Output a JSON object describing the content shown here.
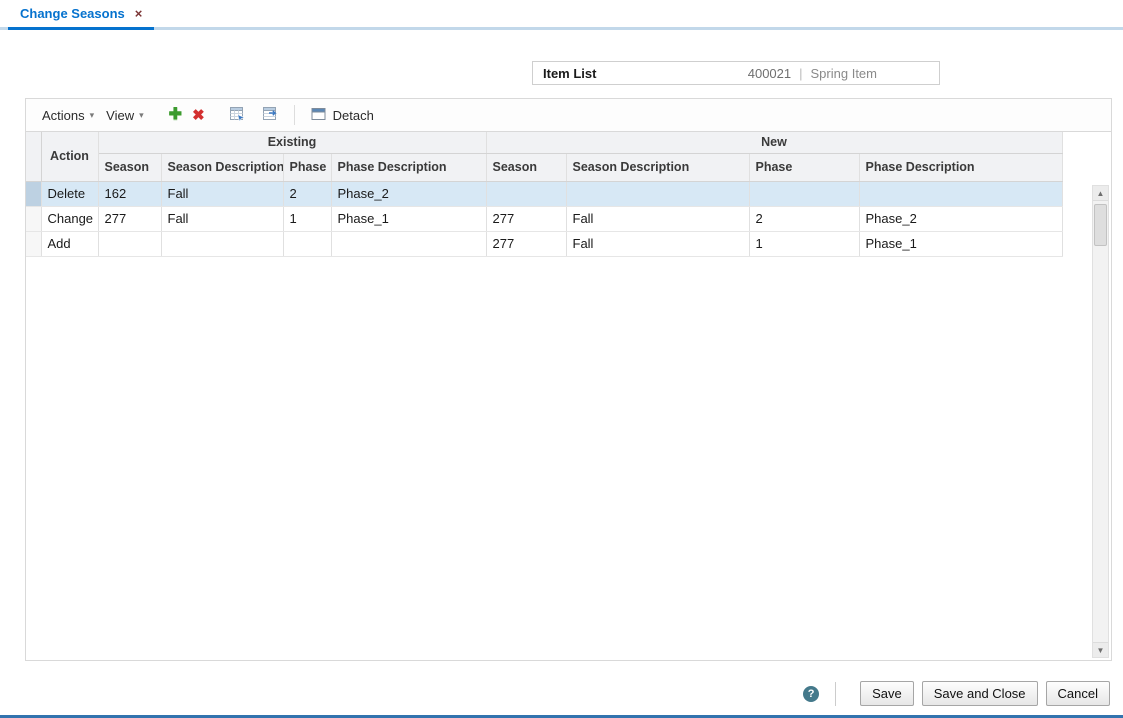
{
  "tab": {
    "title": "Change Seasons",
    "close_glyph": "×"
  },
  "item_list": {
    "label": "Item List",
    "value": "400021",
    "separator": "|",
    "description": "Spring Item"
  },
  "toolbar": {
    "actions_label": "Actions",
    "view_label": "View",
    "detach_label": "Detach",
    "caret_glyph": "▾"
  },
  "icons": {
    "add_glyph": "✚",
    "delete_glyph": "✖",
    "up_arrow": "▲",
    "down_arrow": "▼",
    "help_glyph": "?"
  },
  "table": {
    "group_headers": {
      "existing": "Existing",
      "new": "New"
    },
    "columns": {
      "action": "Action",
      "season": "Season",
      "season_description": "Season Description",
      "phase": "Phase",
      "phase_description": "Phase Description"
    },
    "rows": [
      {
        "action": "Delete",
        "existing": {
          "season": "162",
          "season_description": "Fall",
          "phase": "2",
          "phase_description": "Phase_2"
        },
        "new": {
          "season": "",
          "season_description": "",
          "phase": "",
          "phase_description": ""
        }
      },
      {
        "action": "Change",
        "existing": {
          "season": "277",
          "season_description": "Fall",
          "phase": "1",
          "phase_description": "Phase_1"
        },
        "new": {
          "season": "277",
          "season_description": "Fall",
          "phase": "2",
          "phase_description": "Phase_2"
        }
      },
      {
        "action": "Add",
        "existing": {
          "season": "",
          "season_description": "",
          "phase": "",
          "phase_description": ""
        },
        "new": {
          "season": "277",
          "season_description": "Fall",
          "phase": "1",
          "phase_description": "Phase_1"
        }
      }
    ]
  },
  "footer": {
    "save_label": "Save",
    "save_and_close_label": "Save and Close",
    "cancel_label": "Cancel"
  },
  "colors": {
    "accent_blue": "#0572ce",
    "selected_row": "#d7e8f5",
    "bottom_bar_blue": "#3273ae"
  }
}
